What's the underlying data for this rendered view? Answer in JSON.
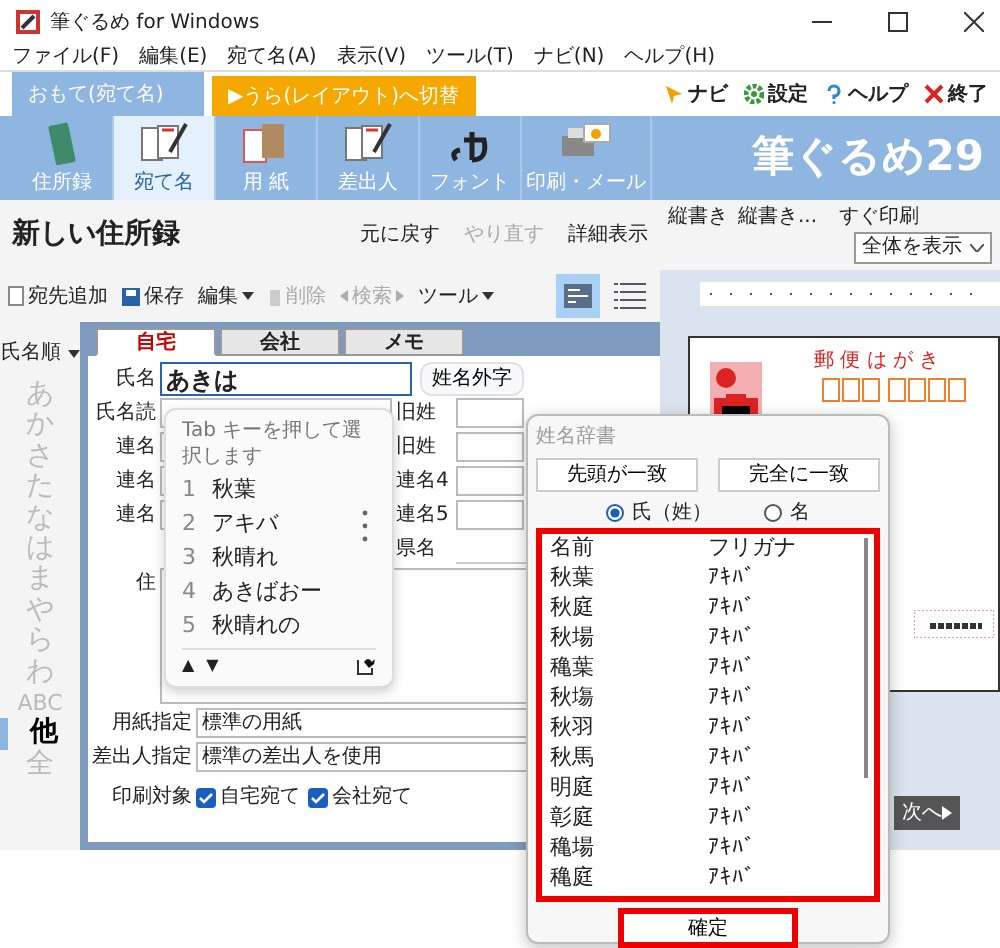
{
  "window": {
    "title": "筆ぐるめ for Windows"
  },
  "menu": [
    "ファイル(F)",
    "編集(E)",
    "宛て名(A)",
    "表示(V)",
    "ツール(T)",
    "ナビ(N)",
    "ヘルプ(H)"
  ],
  "side_tabs": [
    {
      "label": "おもて(宛て名)",
      "kind": "face",
      "selected": true
    },
    {
      "label": "▶うら(レイアウト)へ切替",
      "kind": "switch",
      "selected": false
    }
  ],
  "top_links": [
    {
      "label": "ナビ",
      "kind": "navi"
    },
    {
      "label": "設定",
      "kind": "settings"
    },
    {
      "label": "ヘルプ",
      "kind": "help"
    },
    {
      "label": "終了",
      "kind": "exit"
    }
  ],
  "toolbar": [
    {
      "label": "住所録",
      "kind": "book",
      "selected": false
    },
    {
      "label": "宛て名",
      "kind": "cards",
      "selected": true
    },
    {
      "label": "用 紙",
      "kind": "paper",
      "selected": false
    },
    {
      "label": "差出人",
      "kind": "cards",
      "selected": false
    },
    {
      "label": "フォント",
      "kind": "font",
      "selected": false
    },
    {
      "label": "印刷・メール",
      "kind": "printer",
      "selected": false
    }
  ],
  "logo": "筆ぐるめ29",
  "address_book": {
    "title": "新しい住所録",
    "actions": [
      {
        "label": "元に戻す",
        "disabled": false
      },
      {
        "label": "やり直す",
        "disabled": true
      },
      {
        "label": "詳細表示",
        "disabled": false
      }
    ],
    "commands": [
      {
        "label": "宛先追加",
        "kind": "add",
        "disabled": false
      },
      {
        "label": "保存",
        "kind": "save",
        "disabled": false
      },
      {
        "label": "編集",
        "kind": "menu",
        "disabled": false
      },
      {
        "label": "削除",
        "kind": "delete",
        "disabled": true
      },
      {
        "label": "検索",
        "kind": "search",
        "disabled": true
      },
      {
        "label": "ツール",
        "kind": "menu",
        "disabled": false
      }
    ],
    "views": [
      {
        "kind": "card",
        "selected": true
      },
      {
        "kind": "list",
        "selected": false
      }
    ],
    "sort": "氏名順",
    "index": [
      {
        "label": "あ",
        "selected": false
      },
      {
        "label": "か",
        "selected": false
      },
      {
        "label": "さ",
        "selected": false
      },
      {
        "label": "た",
        "selected": false
      },
      {
        "label": "な",
        "selected": false
      },
      {
        "label": "は",
        "selected": false
      },
      {
        "label": "ま",
        "selected": false
      },
      {
        "label": "や",
        "selected": false
      },
      {
        "label": "ら",
        "selected": false
      },
      {
        "label": "わ",
        "selected": false
      },
      {
        "label": "ABC",
        "selected": false
      },
      {
        "label": "他",
        "selected": true
      },
      {
        "label": "全",
        "selected": false
      }
    ],
    "form_tabs": [
      {
        "label": "自宅",
        "selected": true
      },
      {
        "label": "会社",
        "selected": false
      },
      {
        "label": "メモ",
        "selected": false
      }
    ],
    "name_field": {
      "label": "氏名",
      "value": "あきは"
    },
    "gaiji_button": "姓名外字",
    "fields": [
      {
        "label": "氏名読",
        "side_label": "旧姓"
      },
      {
        "label": "連名",
        "side_label": "旧姓"
      },
      {
        "label": "連名",
        "side_label": "連名4"
      },
      {
        "label": "連名",
        "side_label": "連名5"
      }
    ],
    "prefecture_label": "県名",
    "address_label": "住",
    "paper": {
      "label": "用紙指定",
      "value": "標準の用紙"
    },
    "sender": {
      "label": "差出人指定",
      "value": "標準の差出人を使用"
    },
    "print_target": {
      "label": "印刷対象",
      "options": [
        {
          "label": "自宅宛て",
          "checked": true
        },
        {
          "label": "会社宛て",
          "checked": true
        }
      ]
    }
  },
  "suggestions": {
    "hint": "Tab キーを押して選択します",
    "items": [
      {
        "number": "1",
        "text": "秋葉"
      },
      {
        "number": "2",
        "text": "アキバ"
      },
      {
        "number": "3",
        "text": "秋晴れ"
      },
      {
        "number": "4",
        "text": "あきばおー"
      },
      {
        "number": "5",
        "text": "秋晴れの"
      }
    ],
    "nav": [
      "▲",
      "▼"
    ]
  },
  "preview": {
    "commands": [
      "縦書き",
      "縦書き...",
      "すぐ印刷"
    ],
    "zoom": "全体を表示",
    "postcard_label": "郵 便 は が き",
    "next": "次へ"
  },
  "dictionary": {
    "title": "姓名辞書",
    "match_buttons": [
      "先頭が一致",
      "完全に一致"
    ],
    "modes": [
      {
        "label": "氏（姓）",
        "selected": true
      },
      {
        "label": "名",
        "selected": false
      }
    ],
    "columns": [
      "名前",
      "フリガナ"
    ],
    "rows": [
      [
        "秋葉",
        "ｱｷﾊﾞ"
      ],
      [
        "秋庭",
        "ｱｷﾊﾞ"
      ],
      [
        "秋場",
        "ｱｷﾊﾞ"
      ],
      [
        "穐葉",
        "ｱｷﾊﾞ"
      ],
      [
        "秋塲",
        "ｱｷﾊﾞ"
      ],
      [
        "秋羽",
        "ｱｷﾊﾞ"
      ],
      [
        "秋馬",
        "ｱｷﾊﾞ"
      ],
      [
        "明庭",
        "ｱｷﾊﾞ"
      ],
      [
        "彰庭",
        "ｱｷﾊﾞ"
      ],
      [
        "穐場",
        "ｱｷﾊﾞ"
      ],
      [
        "穐庭",
        "ｱｷﾊﾞ"
      ]
    ],
    "ok": "確定"
  }
}
